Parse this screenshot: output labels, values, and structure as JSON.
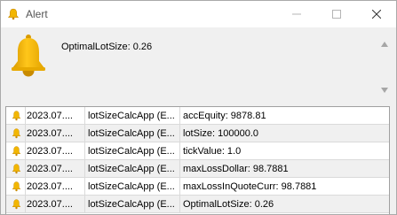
{
  "window": {
    "title": "Alert",
    "icon": "bell-icon",
    "controls": [
      "minimize-icon",
      "maximize-icon",
      "close-icon"
    ]
  },
  "message": {
    "text": "OptimalLotSize: 0.26",
    "icon": "bell-icon"
  },
  "colors": {
    "bell": "#f2b600",
    "bell_dark": "#c98b00",
    "row_alt": "#f0f0f0",
    "border": "#a0a0a0"
  },
  "log": {
    "rows": [
      {
        "time": "2023.07....",
        "source": "lotSizeCalcApp (E...",
        "message": "accEquity: 9878.81"
      },
      {
        "time": "2023.07....",
        "source": "lotSizeCalcApp (E...",
        "message": "lotSize: 100000.0"
      },
      {
        "time": "2023.07....",
        "source": "lotSizeCalcApp (E...",
        "message": "tickValue: 1.0"
      },
      {
        "time": "2023.07....",
        "source": "lotSizeCalcApp (E...",
        "message": "maxLossDollar: 98.7881"
      },
      {
        "time": "2023.07....",
        "source": "lotSizeCalcApp (E...",
        "message": "maxLossInQuoteCurr: 98.7881"
      },
      {
        "time": "2023.07....",
        "source": "lotSizeCalcApp (E...",
        "message": "OptimalLotSize: 0.26"
      }
    ]
  }
}
